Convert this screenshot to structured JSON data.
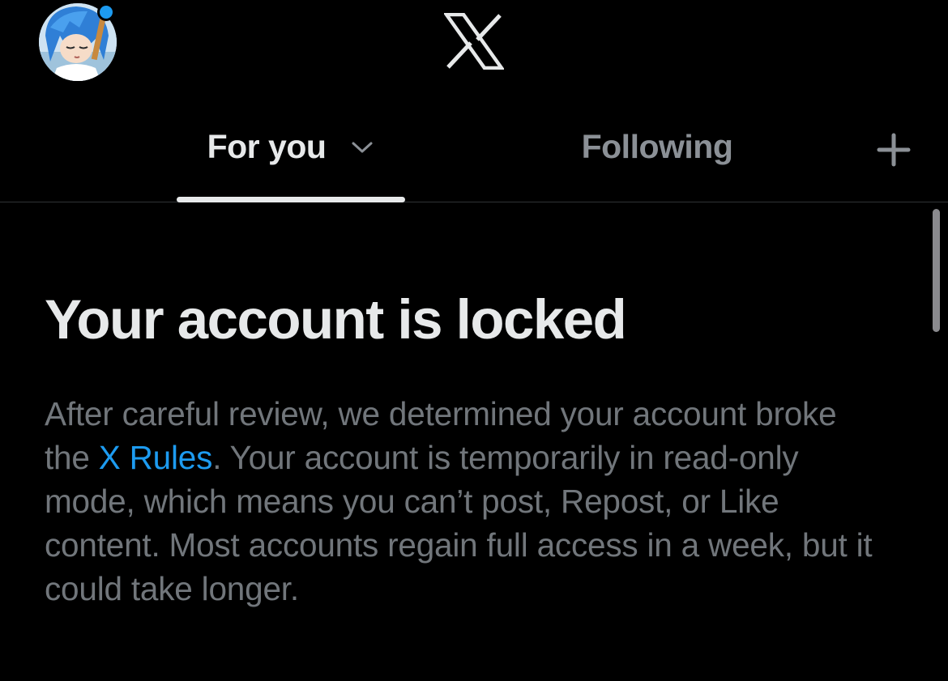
{
  "header": {
    "avatar_alt": "Profile avatar",
    "logo": "x-logo-icon",
    "has_notification_dot": true
  },
  "tabs": [
    {
      "label": "For you",
      "active": true,
      "has_dropdown": true
    },
    {
      "label": "Following",
      "active": false
    }
  ],
  "add_tab_icon": "plus-icon",
  "notice": {
    "title": "Your account is locked",
    "text_before_link": "After careful review, we determined your account broke the ",
    "link_text": "X Rules",
    "text_after_link": ". Your account is temporarily in read-only mode, which means you can’t post, Repost, or Like content. Most accounts regain full access in a week, but it could take longer."
  },
  "colors": {
    "background": "#000000",
    "primary_text": "#e7e9ea",
    "secondary_text": "#71767b",
    "link": "#1d9bf0",
    "divider": "#2f3336"
  }
}
